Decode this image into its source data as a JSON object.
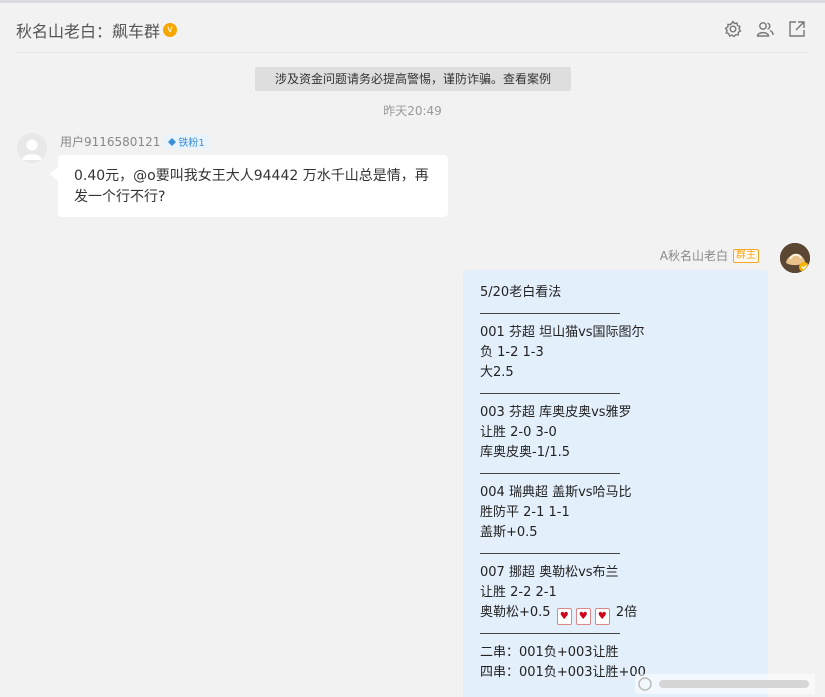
{
  "header": {
    "title": "秋名山老白：飙车群",
    "icons": [
      "gear-icon",
      "users-icon",
      "share-icon"
    ]
  },
  "notice": "涉及资金问题请务必提高警惕，谨防诈骗。查看案例",
  "timestamp": "昨天20:49",
  "incoming": {
    "sender": "用户9116580121",
    "badge": "铁粉1",
    "text_line1": "0.40元，@o要叫我女王大人94442 万水千山总是情，再",
    "text_line2": "发一个行不行?"
  },
  "outgoing": {
    "sender": "A秋名山老白",
    "role_badge": "群主",
    "lines": {
      "l1": "5/20老白看法",
      "l2": "001 芬超 坦山猫vs国际图尔",
      "l3": "负 1-2 1-3",
      "l4": "大2.5",
      "l5": "003 芬超 库奥皮奥vs雅罗",
      "l6": "让胜 2-0 3-0",
      "l7": "库奥皮奥-1/1.5",
      "l8": "004 瑞典超 盖斯vs哈马比",
      "l9": "胜防平 2-1 1-1",
      "l10": "盖斯+0.5",
      "l11": "007 挪超 奥勒松vs布兰",
      "l12": "让胜  2-2 2-1",
      "l13a": "奥勒松+0.5",
      "l13b": "2倍",
      "l14": "二串：001负+003让胜",
      "l15": "四串：001负+003让胜+00"
    }
  },
  "colors": {
    "background": "#f2f2f2",
    "incoming_bubble": "#ffffff",
    "outgoing_bubble": "#e3effb",
    "owner_badge": "#f5a623",
    "fan_badge": "#3a8fd8"
  }
}
